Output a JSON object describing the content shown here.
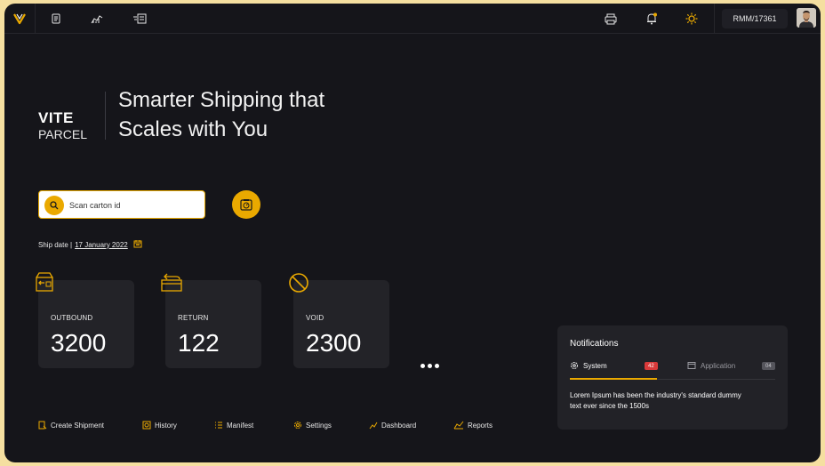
{
  "topbar": {
    "user_id": "RMM/17361"
  },
  "brand": {
    "line1": "VITE",
    "line2": "PARCEL",
    "tagline": "Smarter Shipping that Scales with You"
  },
  "search": {
    "placeholder": "Scan carton id"
  },
  "ship_date": {
    "label": "Ship date |",
    "value": "17 January 2022"
  },
  "stats": [
    {
      "label": "OUTBOUND",
      "value": "3200"
    },
    {
      "label": "RETURN",
      "value": "122"
    },
    {
      "label": "VOID",
      "value": "2300"
    }
  ],
  "nav": [
    {
      "label": "Create Shipment",
      "icon": "create-shipment-icon"
    },
    {
      "label": "History",
      "icon": "history-icon"
    },
    {
      "label": "Manifest",
      "icon": "manifest-icon"
    },
    {
      "label": "Settings",
      "icon": "settings-icon"
    },
    {
      "label": "Dashboard",
      "icon": "dashboard-icon"
    },
    {
      "label": "Reports",
      "icon": "reports-icon"
    }
  ],
  "notifications": {
    "title": "Notifications",
    "tabs": [
      {
        "label": "System",
        "count": "42",
        "active": true
      },
      {
        "label": "Application",
        "count": "04",
        "active": false
      }
    ],
    "message": "Lorem Ipsum has been the industry's standard dummy text ever since the 1500s"
  },
  "colors": {
    "accent": "#eaa900",
    "background": "#15151a",
    "card": "#232328",
    "badge_system": "#d93a3a",
    "badge_application": "#55555c"
  }
}
